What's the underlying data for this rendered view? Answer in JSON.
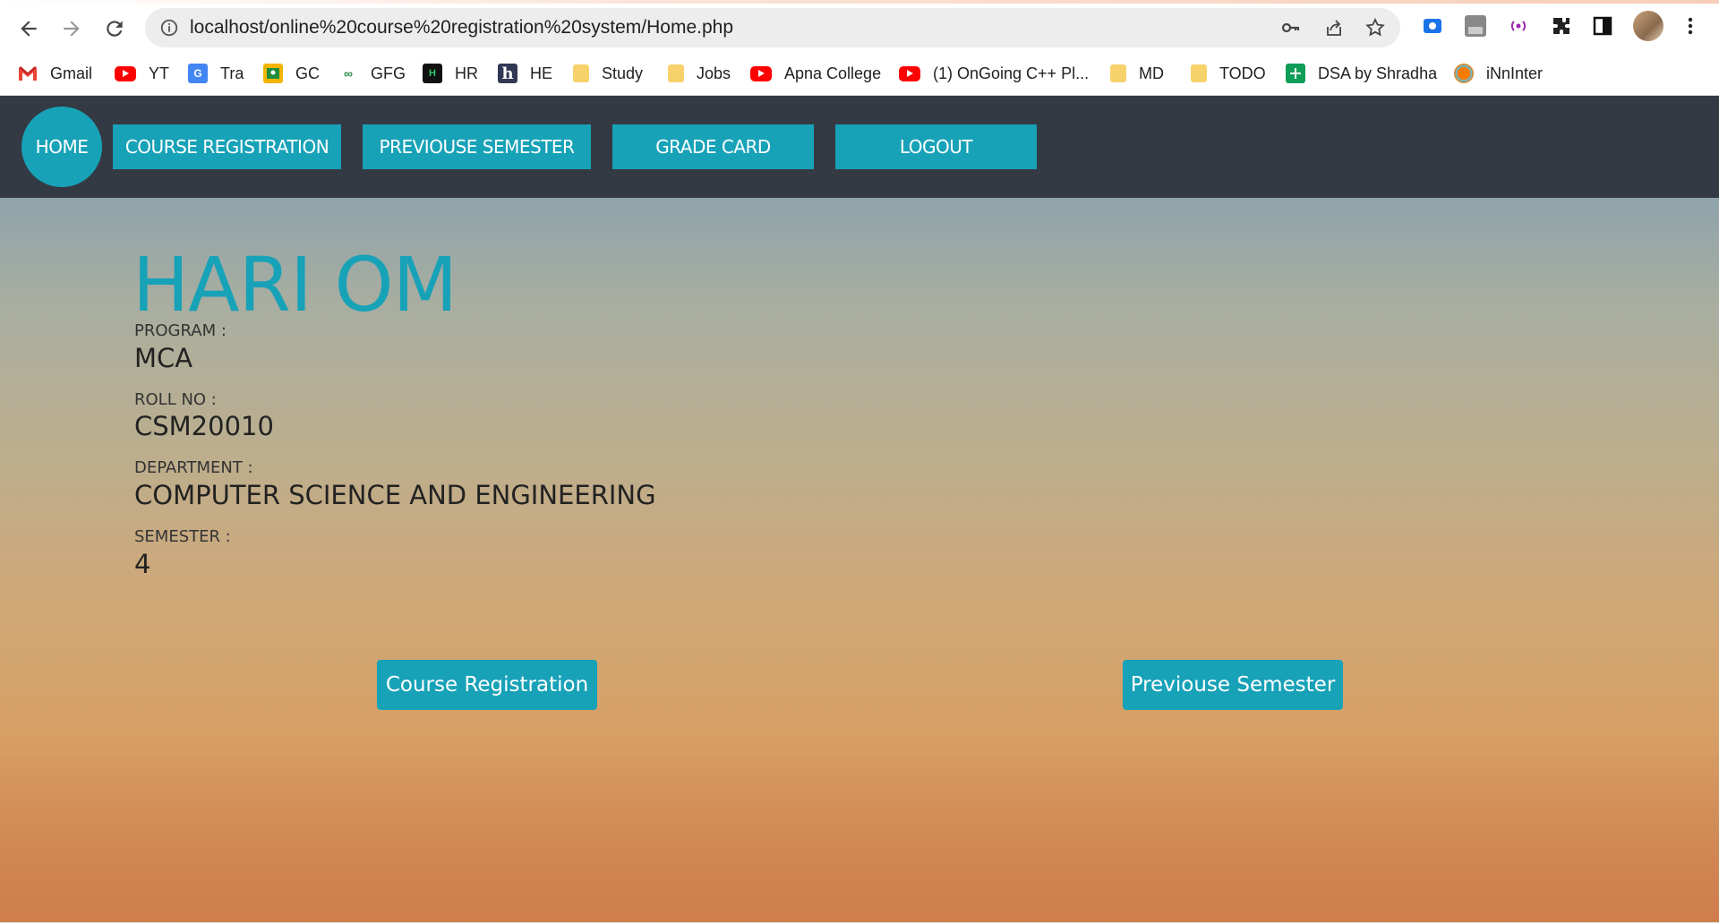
{
  "browser": {
    "url": "localhost/online%20course%20registration%20system/Home.php",
    "icons": [
      "back-icon",
      "forward-icon",
      "reload-icon",
      "info-icon",
      "key-icon",
      "share-icon",
      "star-icon",
      "screencast-icon",
      "extension-icon",
      "podcast-icon",
      "puzzle-icon",
      "sidepanel-icon",
      "avatar",
      "menu-icon"
    ]
  },
  "bookmarks": [
    {
      "label": "Gmail",
      "icon": "gmail-icon"
    },
    {
      "label": "YT",
      "icon": "youtube-icon"
    },
    {
      "label": "Tra",
      "icon": "translate-icon"
    },
    {
      "label": "GC",
      "icon": "classroom-icon"
    },
    {
      "label": "GFG",
      "icon": "gfg-icon"
    },
    {
      "label": "HR",
      "icon": "hackerrank-icon"
    },
    {
      "label": "HE",
      "icon": "hackerearth-icon"
    },
    {
      "label": "Study",
      "icon": "folder-icon"
    },
    {
      "label": "Jobs",
      "icon": "folder-icon"
    },
    {
      "label": "Apna College",
      "icon": "youtube-icon"
    },
    {
      "label": "(1) OnGoing C++ Pl...",
      "icon": "youtube-icon"
    },
    {
      "label": "MD",
      "icon": "folder-icon"
    },
    {
      "label": "TODO",
      "icon": "folder-icon"
    },
    {
      "label": "DSA by Shradha",
      "icon": "sheets-icon"
    },
    {
      "label": "iNnInter",
      "icon": "ininter-icon"
    }
  ],
  "nav": {
    "home": "HOME",
    "course_registration": "COURSE REGISTRATION",
    "previous_semester": "PREVIOUSE SEMESTER",
    "grade_card": "GRADE CARD",
    "logout": "LOGOUT"
  },
  "student": {
    "name": "HARI OM",
    "program_label": "PROGRAM :",
    "program": "MCA",
    "roll_label": "ROLL NO :",
    "roll": "CSM20010",
    "department_label": "DEPARTMENT :",
    "department": "COMPUTER SCIENCE AND ENGINEERING",
    "semester_label": "SEMESTER :",
    "semester": "4"
  },
  "actions": {
    "course_registration": "Course Registration",
    "previous_semester": "Previouse Semester"
  },
  "colors": {
    "accent": "#17a2b8",
    "navbar": "#343a44"
  }
}
